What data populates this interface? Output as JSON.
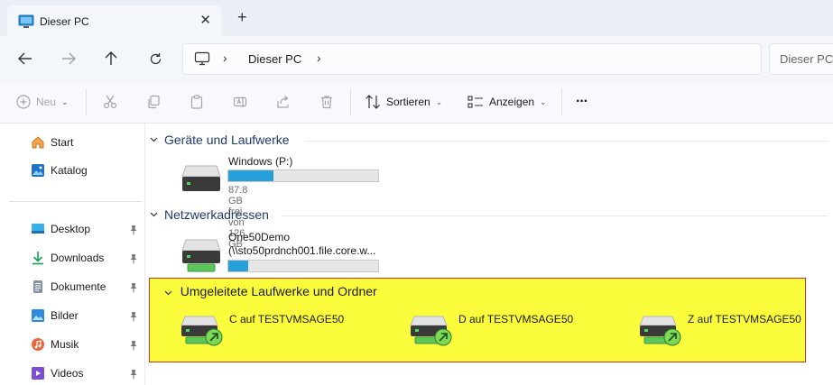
{
  "window": {
    "tab_title": "Dieser PC",
    "tab_close": "✕",
    "new_tab": "+"
  },
  "address": {
    "location": "Dieser PC",
    "separator": "›",
    "search_placeholder": "Dieser PC"
  },
  "toolbar": {
    "new_label": "Neu",
    "sort_label": "Sortieren",
    "view_label": "Anzeigen",
    "more_label": "···",
    "chevron": "⌄"
  },
  "sidebar": {
    "items": [
      {
        "label": "Start",
        "icon": "home-icon"
      },
      {
        "label": "Katalog",
        "icon": "gallery-icon"
      },
      {
        "label": "Desktop",
        "icon": "desktop-icon",
        "pinned": true
      },
      {
        "label": "Downloads",
        "icon": "download-icon",
        "pinned": true
      },
      {
        "label": "Dokumente",
        "icon": "documents-icon",
        "pinned": true
      },
      {
        "label": "Bilder",
        "icon": "pictures-icon",
        "pinned": true
      },
      {
        "label": "Musik",
        "icon": "music-icon",
        "pinned": true
      },
      {
        "label": "Videos",
        "icon": "videos-icon",
        "pinned": true
      }
    ],
    "pin_glyph": "📌"
  },
  "sections": {
    "devices": {
      "title": "Geräte und Laufwerke",
      "drives": [
        {
          "name": "Windows (P:)",
          "free_text": "87.8 GB frei von 126 GB",
          "used_fraction": 0.3
        }
      ]
    },
    "network": {
      "title": "Netzwerkadressen",
      "drives": [
        {
          "name": "One50Demo",
          "path": "(\\\\sto50prdnch001.file.core.w...",
          "used_fraction": 0.13
        }
      ]
    },
    "redirected": {
      "title": "Umgeleitete Laufwerke und Ordner",
      "drives": [
        {
          "name": "C auf TESTVMSAGE50"
        },
        {
          "name": "D auf TESTVMSAGE50"
        },
        {
          "name": "Z auf TESTVMSAGE50"
        }
      ]
    }
  },
  "colors": {
    "highlight": "#fbfc3b",
    "highlight_border": "#c0392b",
    "bar_fill": "#26a0da",
    "section_title": "#1f3a6e"
  }
}
